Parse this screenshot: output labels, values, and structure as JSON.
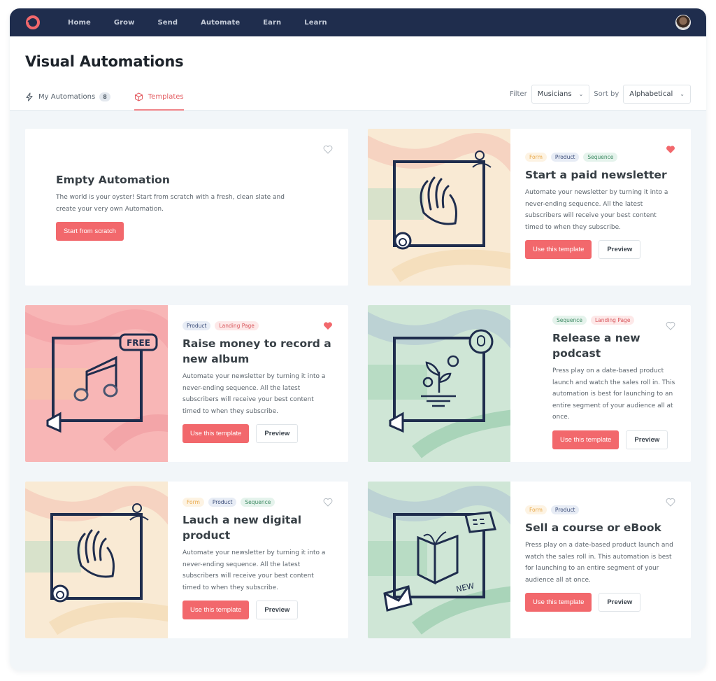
{
  "topbar": {
    "nav": [
      "Home",
      "Grow",
      "Send",
      "Automate",
      "Earn",
      "Learn"
    ],
    "brand_color": "#f2686c",
    "bg_color": "#1f2d4d"
  },
  "header": {
    "title": "Visual Automations",
    "tabs": [
      {
        "label": "My Automations",
        "count": "8",
        "icon": "lightning-icon",
        "active": false
      },
      {
        "label": "Templates",
        "icon": "cube-icon",
        "active": true
      }
    ],
    "filter": {
      "label": "Filter",
      "value": "Musicians"
    },
    "sort": {
      "label": "Sort by",
      "value": "Alphabetical"
    }
  },
  "cards": [
    {
      "title": "Empty Automation",
      "description": "The world is your oyster! Start from scratch with a fresh, clean slate and create your very own Automation.",
      "primary_button": "Start from scratch",
      "favorited": false
    },
    {
      "title": "Start a paid newsletter",
      "tags": [
        "Form",
        "Product",
        "Sequence"
      ],
      "description": "Automate your newsletter by turning it into a never-ending sequence. All the latest subscribers will receive your best content timed to when they subscribe.",
      "primary_button": "Use this template",
      "secondary_button": "Preview",
      "favorited": true,
      "illustration": "waving-hand"
    },
    {
      "title": "Raise money to record a new album",
      "tags": [
        "Product",
        "Landing Page"
      ],
      "description": "Automate your newsletter by turning it into a never-ending sequence. All the latest subscribers will receive your best content timed to when they subscribe.",
      "primary_button": "Use this template",
      "secondary_button": "Preview",
      "favorited": true,
      "illustration": "music-note",
      "illustration_label": "FREE"
    },
    {
      "title": "Release a new podcast",
      "tags": [
        "Sequence",
        "Landing Page"
      ],
      "description": "Press play on a date-based product launch and watch the sales roll in. This automation is best for launching to an entire segment of your audience all at once.",
      "primary_button": "Use this template",
      "secondary_button": "Preview",
      "favorited": false,
      "illustration": "sprout"
    },
    {
      "title": "Lauch a new digital product",
      "tags": [
        "Form",
        "Product",
        "Sequence"
      ],
      "description": "Automate your newsletter by turning it into a never-ending sequence. All the latest subscribers will receive your best content timed to when they subscribe.",
      "primary_button": "Use this template",
      "secondary_button": "Preview",
      "favorited": false,
      "illustration": "waving-hand"
    },
    {
      "title": "Sell a course or eBook",
      "tags": [
        "Form",
        "Product"
      ],
      "description": "Press play on a date-based product launch and watch the sales roll in. This automation is best for launching to an entire segment of your audience all at once.",
      "primary_button": "Use this template",
      "secondary_button": "Preview",
      "favorited": false,
      "illustration": "open-book",
      "illustration_label": "NEW"
    }
  ]
}
